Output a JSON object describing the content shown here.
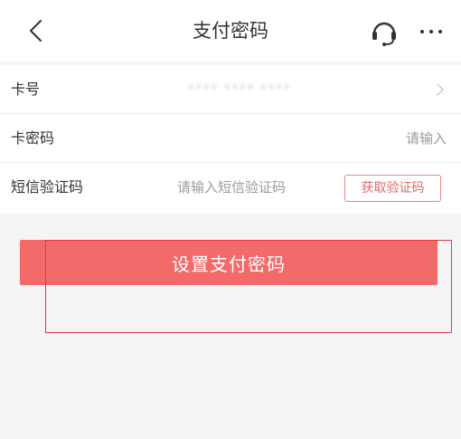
{
  "header": {
    "title": "支付密码",
    "back_icon": "chevron-left-icon",
    "support_icon": "headset-icon",
    "more_icon": "more-horizontal-icon"
  },
  "form": {
    "card_number": {
      "label": "卡号",
      "value": "**** **** ****"
    },
    "card_password": {
      "label": "卡密码",
      "placeholder": "请输入"
    },
    "sms_code": {
      "label": "短信验证码",
      "placeholder": "请输入短信验证码",
      "button_label": "获取验证码"
    }
  },
  "submit": {
    "label": "设置支付密码"
  },
  "colors": {
    "primary": "#f26a6a",
    "sms_button_border": "#e98686",
    "annotation": "#e23b3b",
    "page_background": "#f4f4f4"
  }
}
